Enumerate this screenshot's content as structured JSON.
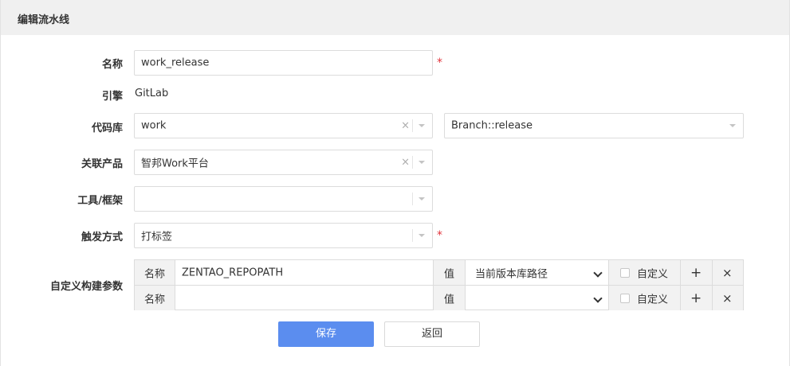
{
  "header": {
    "title": "编辑流水线"
  },
  "form": {
    "name": {
      "label": "名称",
      "value": "work_release",
      "required": "*"
    },
    "engine": {
      "label": "引擎",
      "value": "GitLab"
    },
    "repo": {
      "label": "代码库",
      "value": "work",
      "clear": "×",
      "branch": "Branch::release"
    },
    "product": {
      "label": "关联产品",
      "value": "智邦Work平台",
      "clear": "×"
    },
    "tool": {
      "label": "工具/框架",
      "value": ""
    },
    "trigger": {
      "label": "触发方式",
      "value": "打标签",
      "required": "*"
    },
    "params": {
      "label": "自定义构建参数",
      "rows": [
        {
          "name_label": "名称",
          "name_value": "ZENTAO_REPOPATH",
          "value_label": "值",
          "value_selected": "当前版本库路径",
          "custom_label": "自定义",
          "add": "+",
          "remove": "×"
        },
        {
          "name_label": "名称",
          "name_value": "",
          "value_label": "值",
          "value_selected": "",
          "custom_label": "自定义",
          "add": "+",
          "remove": "×"
        }
      ]
    }
  },
  "actions": {
    "save": "保存",
    "back": "返回"
  },
  "colors": {
    "primary": "#5b8def",
    "required": "#e2343c",
    "header_bg": "#f0f0f0"
  }
}
